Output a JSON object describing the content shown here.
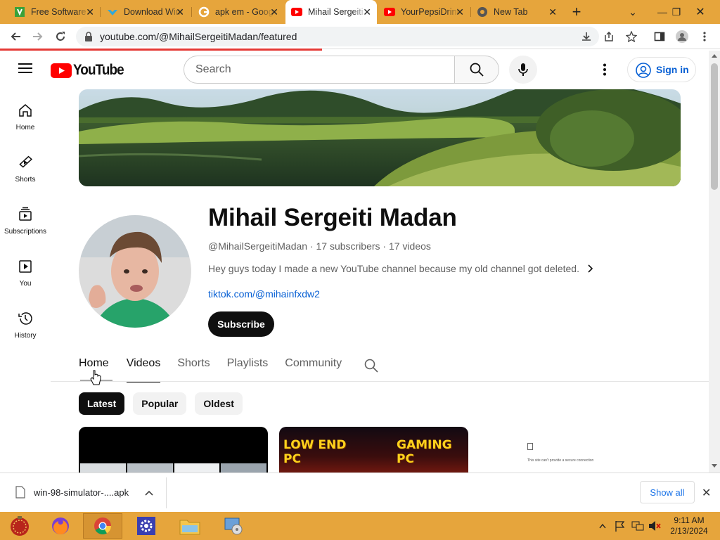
{
  "browser": {
    "tabs": [
      {
        "title": "Free Software",
        "icon": "green-download-icon"
      },
      {
        "title": "Download WinRAR",
        "icon": "blue-download-icon"
      },
      {
        "title": "apk em - Google",
        "icon": "google-icon"
      },
      {
        "title": "Mihail Sergeiti",
        "icon": "youtube-icon",
        "active": true
      },
      {
        "title": "YourPepsiDrink",
        "icon": "youtube-icon"
      },
      {
        "title": "New Tab",
        "icon": "chrome-icon"
      }
    ],
    "url": "youtube.com/@MihailSergeitiMadan/featured"
  },
  "youtube": {
    "logo_text": "YouTube",
    "search_placeholder": "Search",
    "signin_label": "Sign in",
    "guide": [
      {
        "label": "Home",
        "icon": "home-icon"
      },
      {
        "label": "Shorts",
        "icon": "shorts-icon"
      },
      {
        "label": "Subscriptions",
        "icon": "subscriptions-icon"
      },
      {
        "label": "You",
        "icon": "you-icon"
      },
      {
        "label": "History",
        "icon": "history-icon"
      }
    ],
    "channel": {
      "name": "Mihail Sergeiti Madan",
      "meta": "@MihailSergeitiMadan · 17 subscribers · 17 videos",
      "description": "Hey guys today I made a new YouTube channel because my old channel got deleted.",
      "link": "tiktok.com/@mihainfxdw2",
      "subscribe_label": "Subscribe"
    },
    "tabs": [
      "Home",
      "Videos",
      "Shorts",
      "Playlists",
      "Community"
    ],
    "selected_tab": "Videos",
    "chips": [
      "Latest",
      "Popular",
      "Oldest"
    ],
    "selected_chip": "Latest",
    "video_thumbs": [
      {
        "text_left": "LOW END\nPC",
        "text_right": "GAMING\nPC"
      }
    ],
    "third_thumb_text": "This site can't provide a secure connection"
  },
  "download_bar": {
    "file_name": "win-98-simulator-....apk",
    "show_all_label": "Show all"
  },
  "taskbar": {
    "time": "9:11 AM",
    "date": "2/13/2024"
  }
}
